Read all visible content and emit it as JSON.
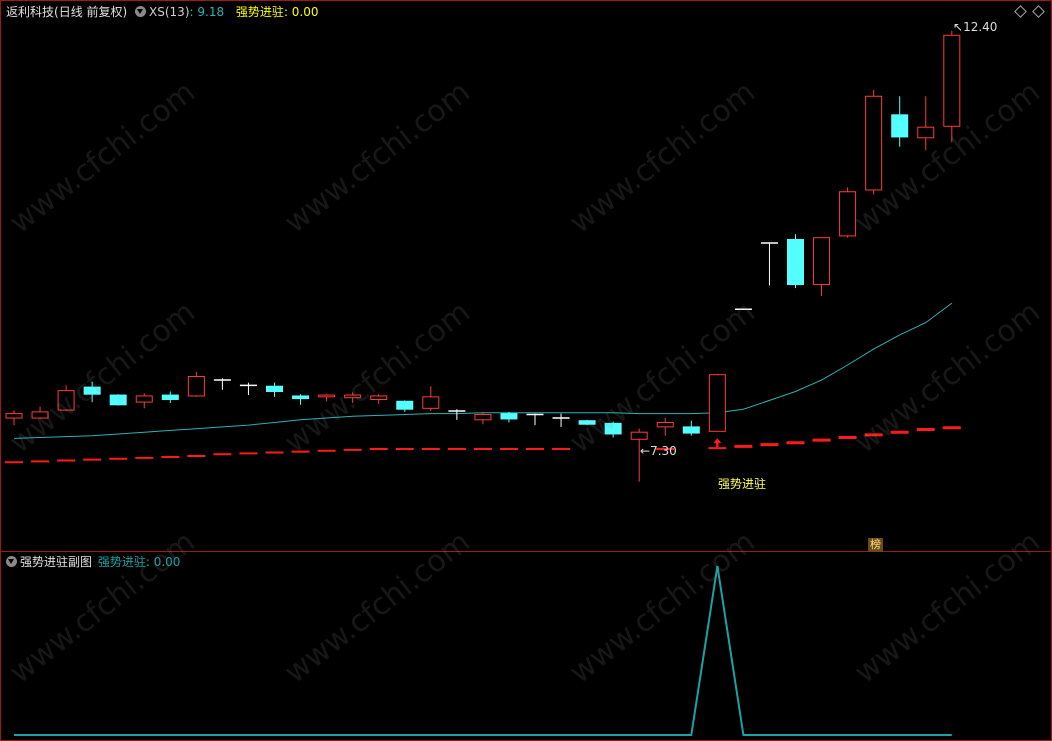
{
  "main_panel": {
    "stock_name": "返利科技",
    "period_label": "(日线 前复权)",
    "indicator_name": "XS(13)",
    "indicator_value": ": 9.18",
    "signal_name": "强势进驻",
    "signal_value": ": 0.00",
    "max_price_label": "12.40",
    "min_price_label": "7.30",
    "signal_annotation": "强势进驻",
    "badge_text": "榜"
  },
  "sub_panel": {
    "title": "强势进驻副图",
    "series_name": "强势进驻",
    "series_value": ": 0.00"
  },
  "watermark": "www.cfchi.com",
  "colors": {
    "background": "#000000",
    "up": "#ff3a3a",
    "down": "#54ffff",
    "flat": "#ffffff",
    "ma_line": "#2bb3b3",
    "support_line": "#ff1a1a",
    "border": "#a01818",
    "signal_text": "#ffff00",
    "sub_line": "#1aa3a3"
  },
  "chart_data": {
    "type": "candlestick",
    "title": "返利科技 (日线 前复权)",
    "ohlc": [
      {
        "o": 8.02,
        "h": 8.11,
        "l": 7.94,
        "c": 8.07
      },
      {
        "o": 8.02,
        "h": 8.15,
        "l": 8.01,
        "c": 8.09
      },
      {
        "o": 8.11,
        "h": 8.39,
        "l": 8.1,
        "c": 8.33
      },
      {
        "o": 8.37,
        "h": 8.43,
        "l": 8.2,
        "c": 8.29
      },
      {
        "o": 8.28,
        "h": 8.29,
        "l": 8.16,
        "c": 8.17
      },
      {
        "o": 8.2,
        "h": 8.3,
        "l": 8.13,
        "c": 8.27
      },
      {
        "o": 8.28,
        "h": 8.32,
        "l": 8.19,
        "c": 8.23
      },
      {
        "o": 8.27,
        "h": 8.54,
        "l": 8.26,
        "c": 8.49
      },
      {
        "o": 8.45,
        "h": 8.47,
        "l": 8.34,
        "c": 8.45
      },
      {
        "o": 8.39,
        "h": 8.42,
        "l": 8.28,
        "c": 8.39
      },
      {
        "o": 8.38,
        "h": 8.42,
        "l": 8.26,
        "c": 8.32
      },
      {
        "o": 8.27,
        "h": 8.29,
        "l": 8.17,
        "c": 8.24
      },
      {
        "o": 8.26,
        "h": 8.29,
        "l": 8.21,
        "c": 8.28
      },
      {
        "o": 8.25,
        "h": 8.31,
        "l": 8.19,
        "c": 8.28
      },
      {
        "o": 8.23,
        "h": 8.29,
        "l": 8.18,
        "c": 8.27
      },
      {
        "o": 8.21,
        "h": 8.22,
        "l": 8.09,
        "c": 8.12
      },
      {
        "o": 8.13,
        "h": 8.38,
        "l": 8.1,
        "c": 8.26
      },
      {
        "o": 8.1,
        "h": 8.12,
        "l": 8.0,
        "c": 8.1
      },
      {
        "o": 8.0,
        "h": 8.09,
        "l": 7.95,
        "c": 8.06
      },
      {
        "o": 8.07,
        "h": 8.09,
        "l": 7.97,
        "c": 8.01
      },
      {
        "o": 8.06,
        "h": 8.07,
        "l": 7.94,
        "c": 8.06
      },
      {
        "o": 8.02,
        "h": 8.07,
        "l": 7.92,
        "c": 8.02
      },
      {
        "o": 7.99,
        "h": 8.0,
        "l": 7.94,
        "c": 7.95
      },
      {
        "o": 7.96,
        "h": 7.98,
        "l": 7.8,
        "c": 7.84
      },
      {
        "o": 7.78,
        "h": 7.9,
        "l": 7.3,
        "c": 7.86
      },
      {
        "o": 7.92,
        "h": 8.02,
        "l": 7.82,
        "c": 7.97
      },
      {
        "o": 7.92,
        "h": 7.99,
        "l": 7.82,
        "c": 7.85
      },
      {
        "o": 7.87,
        "h": 8.52,
        "l": 7.87,
        "c": 8.51
      },
      {
        "o": 9.25,
        "h": 9.25,
        "l": 9.25,
        "c": 9.25
      },
      {
        "o": 10.0,
        "h": 10.0,
        "l": 9.52,
        "c": 10.0
      },
      {
        "o": 10.04,
        "h": 10.1,
        "l": 9.49,
        "c": 9.53
      },
      {
        "o": 9.53,
        "h": 10.05,
        "l": 9.4,
        "c": 10.06
      },
      {
        "o": 10.08,
        "h": 10.63,
        "l": 10.06,
        "c": 10.58
      },
      {
        "o": 10.6,
        "h": 11.73,
        "l": 10.55,
        "c": 11.66
      },
      {
        "o": 11.45,
        "h": 11.66,
        "l": 11.09,
        "c": 11.2
      },
      {
        "o": 11.19,
        "h": 11.66,
        "l": 11.05,
        "c": 11.31
      },
      {
        "o": 11.32,
        "h": 12.4,
        "l": 11.14,
        "c": 12.35
      }
    ],
    "ma_line": [
      7.79,
      7.8,
      7.81,
      7.82,
      7.84,
      7.86,
      7.88,
      7.9,
      7.92,
      7.94,
      7.97,
      8.0,
      8.02,
      8.04,
      8.05,
      8.06,
      8.07,
      8.07,
      8.08,
      8.08,
      8.08,
      8.08,
      8.08,
      8.08,
      8.07,
      8.07,
      8.07,
      8.08,
      8.12,
      8.22,
      8.32,
      8.45,
      8.62,
      8.8,
      8.96,
      9.1,
      9.32
    ],
    "support_line": [
      7.52,
      7.53,
      7.54,
      7.55,
      7.56,
      7.57,
      7.58,
      7.59,
      7.61,
      7.62,
      7.63,
      7.64,
      7.65,
      7.66,
      7.67,
      7.67,
      7.67,
      7.67,
      7.67,
      7.67,
      7.67,
      7.67,
      null,
      null,
      null,
      7.67,
      null,
      7.68,
      7.7,
      7.72,
      7.74,
      7.77,
      7.8,
      7.83,
      7.86,
      7.89,
      7.91
    ],
    "price_range": [
      6.55,
      12.5
    ],
    "signal_index": 27,
    "sub_series": [
      0,
      0,
      0,
      0,
      0,
      0,
      0,
      0,
      0,
      0,
      0,
      0,
      0,
      0,
      0,
      0,
      0,
      0,
      0,
      0,
      0,
      0,
      0,
      0,
      0,
      0,
      0,
      1,
      0,
      0,
      0,
      0,
      0,
      0,
      0,
      0,
      0
    ],
    "sub_range": [
      0,
      1
    ]
  }
}
